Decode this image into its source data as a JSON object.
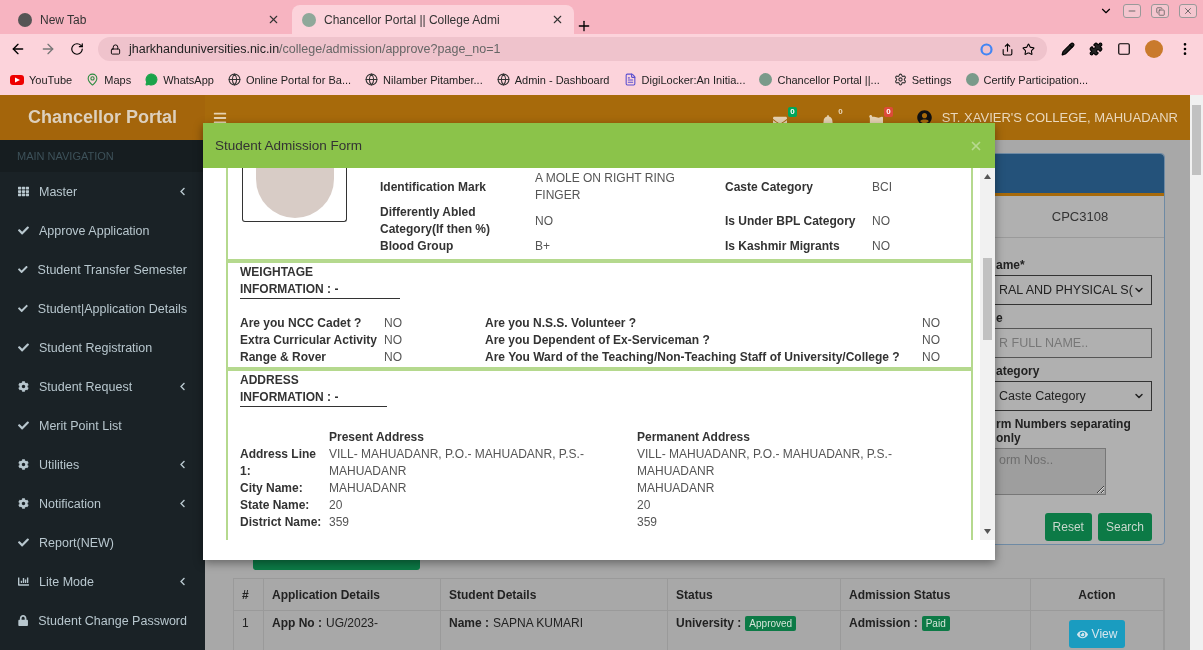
{
  "browser": {
    "tabs": [
      {
        "title": "New Tab",
        "selected": false
      },
      {
        "title": "Chancellor Portal || College Admi",
        "selected": true
      }
    ],
    "url_host": "jharkhanduniversities.nic.in",
    "url_path": "/college/admission/approve?page_no=1",
    "bookmarks": [
      {
        "label": "YouTube",
        "kind": "video"
      },
      {
        "label": "Maps",
        "kind": "pin"
      },
      {
        "label": "WhatsApp",
        "kind": "chat"
      },
      {
        "label": "Online Portal for Ba...",
        "kind": "globe"
      },
      {
        "label": "Nilamber Pitamber...",
        "kind": "globe"
      },
      {
        "label": "Admin - Dashboard",
        "kind": "globe"
      },
      {
        "label": "DigiLocker:An Initia...",
        "kind": "document"
      },
      {
        "label": "Chancellor Portal ||...",
        "kind": "site"
      },
      {
        "label": "Settings",
        "kind": "gear"
      },
      {
        "label": "Certify Participation...",
        "kind": "site"
      }
    ]
  },
  "sidebar": {
    "brand": "Chancellor Portal",
    "section": "MAIN NAVIGATION",
    "items": [
      {
        "label": "Master",
        "kind": "grid",
        "expandable": true
      },
      {
        "label": "Approve Application",
        "kind": "check",
        "expandable": false
      },
      {
        "label": "Student Transfer Semester",
        "kind": "check",
        "expandable": false
      },
      {
        "label": "Student|Application Details",
        "kind": "check",
        "expandable": false
      },
      {
        "label": "Student Registration",
        "kind": "check",
        "expandable": false
      },
      {
        "label": "Student Request",
        "kind": "gear",
        "expandable": true
      },
      {
        "label": "Merit Point List",
        "kind": "check",
        "expandable": false
      },
      {
        "label": "Utilities",
        "kind": "gear",
        "expandable": true
      },
      {
        "label": "Notification",
        "kind": "gear",
        "expandable": true
      },
      {
        "label": "Report(NEW)",
        "kind": "check",
        "expandable": false
      },
      {
        "label": "Lite Mode",
        "kind": "chart",
        "expandable": true
      },
      {
        "label": "Student Change Password",
        "kind": "lock",
        "expandable": false
      }
    ]
  },
  "header": {
    "notifications": [
      {
        "kind": "mail",
        "count": "0",
        "color": "#00a65a"
      },
      {
        "kind": "bell",
        "count": "0"
      },
      {
        "kind": "flag",
        "count": "0",
        "color": "#dd4b39"
      }
    ],
    "user": "ST. XAVIER'S COLLEGE, MAHUADANR"
  },
  "filter_card": {
    "code": "CPC3108",
    "fields": [
      {
        "kind": "select",
        "label": "ame*",
        "value": "RAL AND PHYSICAL S("
      },
      {
        "kind": "input",
        "label": "e",
        "placeholder": "R FULL NAME.."
      },
      {
        "kind": "select",
        "label": "ategory",
        "value": "Caste Category"
      },
      {
        "kind": "textarea",
        "label": "rm Numbers separating only",
        "placeholder": "orm Nos.."
      }
    ],
    "buttons": [
      "Reset",
      "Search"
    ]
  },
  "table": {
    "columns": [
      "#",
      "Application Details",
      "Student Details",
      "Status",
      "Admission Status",
      "Action"
    ],
    "rows": [
      {
        "number": "1",
        "application_label": "App No :",
        "application_value": "UG/2023-",
        "student_label": "Name :",
        "student_value": "SAPNA KUMARI",
        "status_label": "University :",
        "status_badge": "Approved",
        "admission_label": "Admission :",
        "admission_badge": "Paid",
        "action": "View"
      }
    ]
  },
  "modal": {
    "title": "Student Admission Form",
    "personal_rows": [
      {
        "label": "Identification Mark",
        "value": "A MOLE ON RIGHT RING FINGER",
        "label2": "Caste Category",
        "value2": "BCI"
      },
      {
        "label": "Differently Abled Category(If then %)",
        "value": "NO",
        "label2": "Is Under BPL Category",
        "value2": "NO"
      },
      {
        "label": "Blood Group",
        "value": "B+",
        "label2": "Is Kashmir Migrants",
        "value2": "NO"
      }
    ],
    "weightage": {
      "title": "WEIGHTAGE INFORMATION : -",
      "rows": [
        {
          "label": "Are you NCC Cadet ?",
          "value": "NO",
          "label2": "Are you N.S.S. Volunteer ?",
          "value2": "NO"
        },
        {
          "label": "Extra Curricular Activity",
          "value": "NO",
          "label2": "Are you Dependent of Ex-Serviceman ?",
          "value2": "NO"
        },
        {
          "label": "Range & Rover",
          "value": "NO",
          "label2": "Are You Ward of the Teaching/Non-Teaching Staff of University/College ?",
          "value2": "NO"
        }
      ]
    },
    "address": {
      "title": "ADDRESS INFORMATION : -",
      "present_heading": "Present Address",
      "permanent_heading": "Permanent Address",
      "rows": [
        {
          "label": "Address Line 1:",
          "present": "VILL- MAHUADANR, P.O.- MAHUADANR, P.S.- MAHUADANR",
          "permanent": "VILL- MAHUADANR, P.O.- MAHUADANR, P.S.- MAHUADANR"
        },
        {
          "label": "City Name:",
          "present": "MAHUADANR",
          "permanent": "MAHUADANR"
        },
        {
          "label": "State Name:",
          "present": "20",
          "permanent": "20"
        },
        {
          "label": "District Name:",
          "present": "359",
          "permanent": "359"
        }
      ]
    }
  }
}
